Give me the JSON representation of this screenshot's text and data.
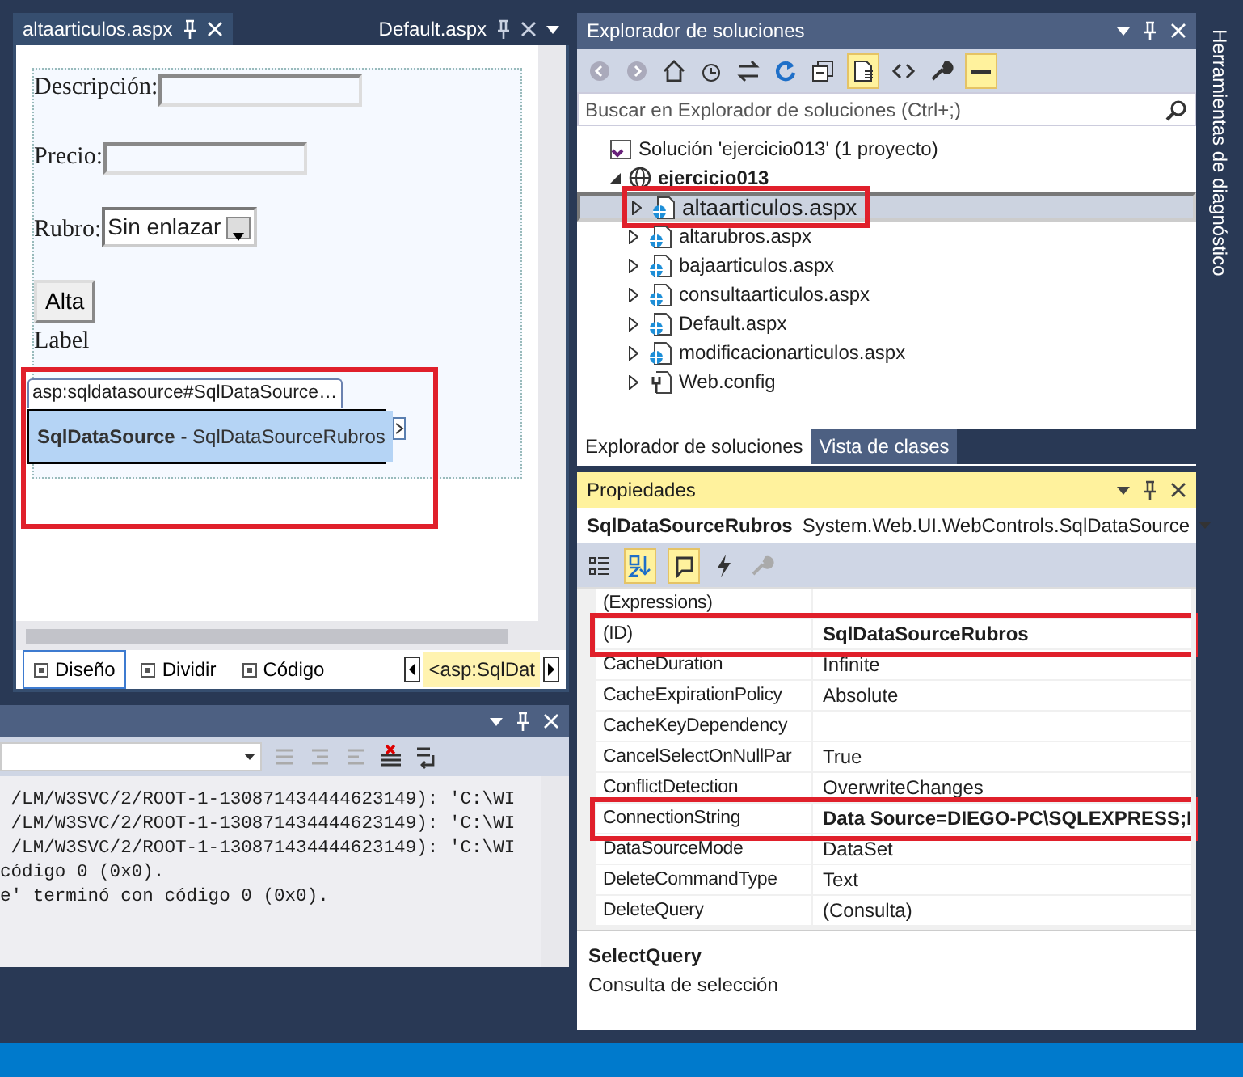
{
  "editor": {
    "tabs": [
      {
        "label": "altaarticulos.aspx",
        "selected": true
      },
      {
        "label": "Default.aspx",
        "selected": false
      }
    ],
    "form": {
      "fields": [
        {
          "kind": "text",
          "label": "Descripción:"
        },
        {
          "kind": "text",
          "label": "Precio:"
        },
        {
          "kind": "select",
          "label": "Rubro:",
          "value": "Sin enlazar"
        }
      ],
      "button": "Alta",
      "caption": "Label",
      "tag": "asp:sqldatasource#SqlDataSource…",
      "smart_tag": {
        "title": "SqlDataSource",
        "detail": " - SqlDataSourceRubros",
        "highlighted": true
      }
    },
    "view_tabs": [
      {
        "label": "Diseño",
        "selected": true
      },
      {
        "label": "Dividir",
        "selected": false
      },
      {
        "label": "Código",
        "selected": false
      }
    ],
    "breadcrumb": "<asp:SqlDat"
  },
  "output": {
    "lines": [
      " /LM/W3SVC/2/ROOT-1-130871434444623149): 'C:\\WI",
      " /LM/W3SVC/2/ROOT-1-130871434444623149): 'C:\\WI",
      " /LM/W3SVC/2/ROOT-1-130871434444623149): 'C:\\WI",
      "código 0 (0x0).",
      "e' terminó con código 0 (0x0)."
    ]
  },
  "solution_explorer": {
    "title": "Explorador de soluciones",
    "search": {
      "placeholder": "Buscar en Explorador de soluciones (Ctrl+;)"
    },
    "tree": [
      {
        "kind": "solution",
        "label": "Solución 'ejercicio013'  (1 proyecto)",
        "children": [
          {
            "kind": "project",
            "label": "ejercicio013",
            "expanded": true,
            "children": [
              {
                "kind": "page",
                "label": "altaarticulos.aspx",
                "expanded": false,
                "selected": true,
                "highlighted": true
              },
              {
                "kind": "page",
                "label": "altarubros.aspx",
                "expanded": false,
                "selected": false,
                "highlighted": false
              },
              {
                "kind": "page",
                "label": "bajaarticulos.aspx",
                "expanded": false,
                "selected": false,
                "highlighted": false
              },
              {
                "kind": "page",
                "label": "consultaarticulos.aspx",
                "expanded": false,
                "selected": false,
                "highlighted": false
              },
              {
                "kind": "page",
                "label": "Default.aspx",
                "expanded": false,
                "selected": false,
                "highlighted": false
              },
              {
                "kind": "page",
                "label": "modificacionarticulos.aspx",
                "expanded": false,
                "selected": false,
                "highlighted": false
              },
              {
                "kind": "config",
                "label": "Web.config",
                "expanded": false,
                "selected": false,
                "highlighted": false
              }
            ]
          }
        ]
      }
    ],
    "tabs": [
      {
        "label": "Explorador de soluciones",
        "selected": true
      },
      {
        "label": "Vista de clases",
        "selected": false
      }
    ]
  },
  "properties": {
    "title": "Propiedades",
    "object": "SqlDataSourceRubros",
    "type": "System.Web.UI.WebControls.SqlDataSource",
    "rows": [
      {
        "name": "(Expressions)",
        "value": "",
        "modified": false,
        "highlighted": false
      },
      {
        "name": "(ID)",
        "value": "SqlDataSourceRubros",
        "modified": true,
        "highlighted": true
      },
      {
        "name": "CacheDuration",
        "value": "Infinite",
        "modified": false,
        "highlighted": false
      },
      {
        "name": "CacheExpirationPolicy",
        "value": "Absolute",
        "modified": false,
        "highlighted": false
      },
      {
        "name": "CacheKeyDependency",
        "value": "",
        "modified": false,
        "highlighted": false
      },
      {
        "name": "CancelSelectOnNullPar",
        "value": "True",
        "modified": false,
        "highlighted": false
      },
      {
        "name": "ConflictDetection",
        "value": "OverwriteChanges",
        "modified": false,
        "highlighted": false
      },
      {
        "name": "ConnectionString",
        "value": "Data Source=DIEGO-PC\\SQLEXPRESS;I",
        "modified": true,
        "highlighted": true
      },
      {
        "name": "DataSourceMode",
        "value": "DataSet",
        "modified": false,
        "highlighted": false
      },
      {
        "name": "DeleteCommandType",
        "value": "Text",
        "modified": false,
        "highlighted": false
      },
      {
        "name": "DeleteQuery",
        "value": "(Consulta)",
        "modified": false,
        "highlighted": false
      }
    ],
    "description": {
      "title": "SelectQuery",
      "text": "Consulta de selección"
    }
  },
  "side_tab": "Herramientas de diagnóstico"
}
